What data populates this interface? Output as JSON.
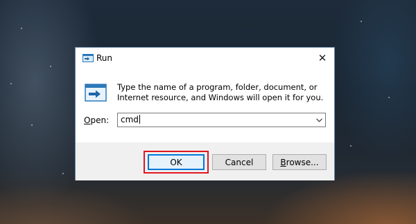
{
  "dialog": {
    "title": "Run",
    "title_icon": "run-icon",
    "close_label": "✕",
    "message": "Type the name of a program, folder, document, or Internet resource, and Windows will open it for you.",
    "open_label_underlined": "O",
    "open_label_rest": "pen:",
    "input_value": "cmd",
    "dropdown_icon": "chevron-down-icon",
    "buttons": {
      "ok": "OK",
      "cancel": "Cancel",
      "browse_underlined": "B",
      "browse_rest": "rowse..."
    },
    "highlight_color": "#e0151d",
    "accent_color": "#0078d7"
  }
}
